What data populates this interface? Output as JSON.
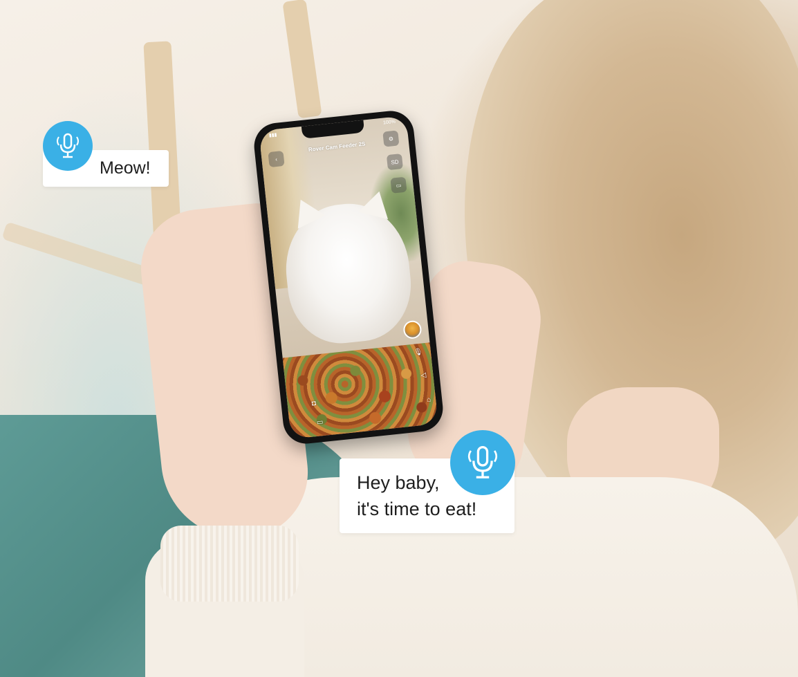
{
  "phone_app": {
    "title": "Rover Cam Feeder 2S",
    "battery": "100%",
    "sd_label": "SD",
    "back_icon": "chevron-left-icon",
    "settings_icon": "gear-icon",
    "record_icon": "battery-icon",
    "controls": [
      "camera-icon",
      "video-icon",
      "microphone-icon",
      "speaker-icon",
      "feed-icon"
    ]
  },
  "bubbles": {
    "meow": "Meow!",
    "hey_line1": "Hey baby,",
    "hey_line2": "it's time to eat!"
  },
  "colors": {
    "mic_blue": "#3ab0e6",
    "bubble_bg": "#ffffff",
    "text": "#1e1e1e"
  }
}
